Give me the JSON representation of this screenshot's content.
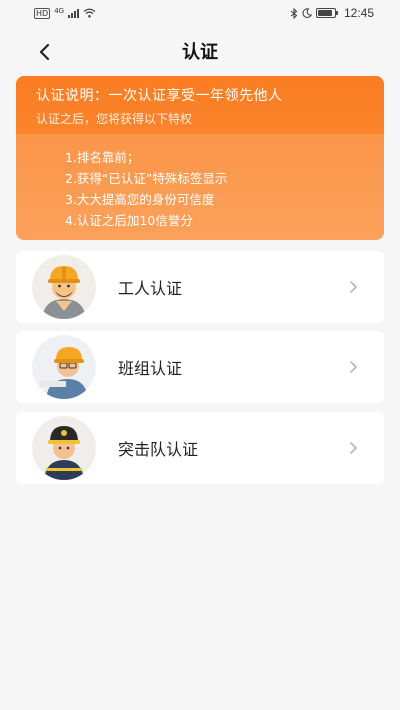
{
  "status_bar": {
    "left_badge": "HD",
    "network_label": "4G",
    "time": "12:45",
    "battery_level": 0.85,
    "icons": [
      "signal-icon",
      "wifi-icon",
      "bluetooth-icon",
      "moon-icon",
      "battery-icon"
    ]
  },
  "header": {
    "back_icon": "chevron-left-icon",
    "title": "认证"
  },
  "info_card": {
    "heading": "认证说明：一次认证享受一年领先他人",
    "subheading": "认证之后，您将获得以下特权",
    "privileges": [
      "1.排名靠前；",
      "2.获得“已认证”特殊标签显示",
      "3.大大提高您的身份可信度",
      "4.认证之后加10信誉分"
    ],
    "color_top": "#fb7d22",
    "color_bottom": "#fb9240"
  },
  "certifications": [
    {
      "label": "工人认证",
      "avatar": "worker-avatar-icon"
    },
    {
      "label": "班组认证",
      "avatar": "team-avatar-icon"
    },
    {
      "label": "突击队认证",
      "avatar": "commando-avatar-icon"
    }
  ]
}
